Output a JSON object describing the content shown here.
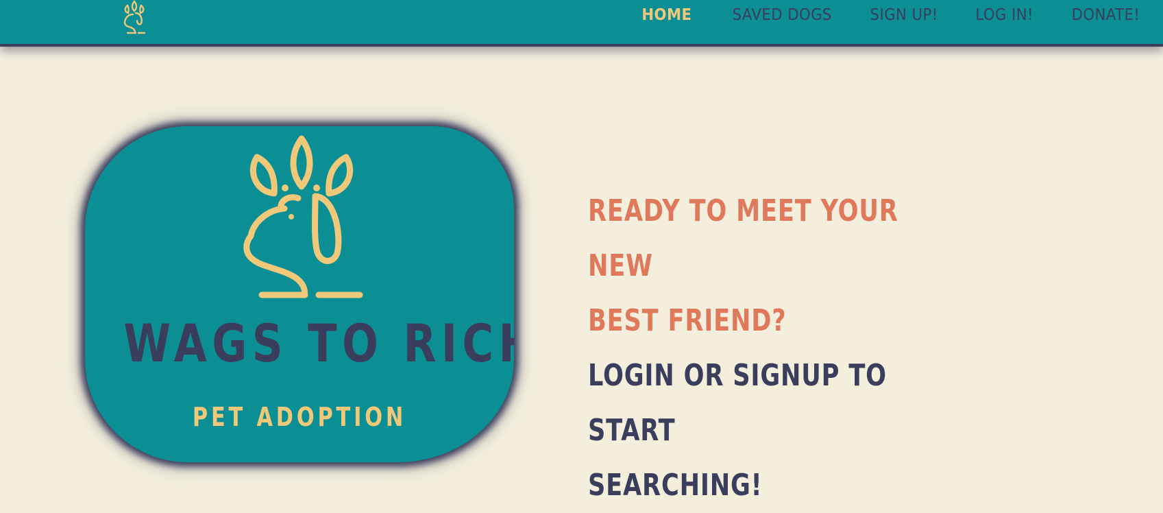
{
  "nav": {
    "logo_icon": "crowned-dog-icon",
    "links": [
      {
        "label": "HOME",
        "active": true
      },
      {
        "label": "SAVED DOGS",
        "active": false
      },
      {
        "label": "SIGN UP!",
        "active": false
      },
      {
        "label": "LOG IN!",
        "active": false
      },
      {
        "label": "DONATE!",
        "active": false
      }
    ]
  },
  "hero": {
    "logo_icon": "crowned-dog-icon",
    "brand_title": "WAGS TO RICHES",
    "brand_subtitle": "PET ADOPTION",
    "headline_line1": "READY TO MEET YOUR NEW",
    "headline_line2": "BEST FRIEND?",
    "subline_line1": "LOGIN OR SIGNUP TO START",
    "subline_line2": "SEARCHING!"
  },
  "colors": {
    "teal": "#0b8f94",
    "navy": "#3a3d5c",
    "gold": "#f0c879",
    "coral": "#e0795b",
    "cream": "#f4efdd"
  }
}
